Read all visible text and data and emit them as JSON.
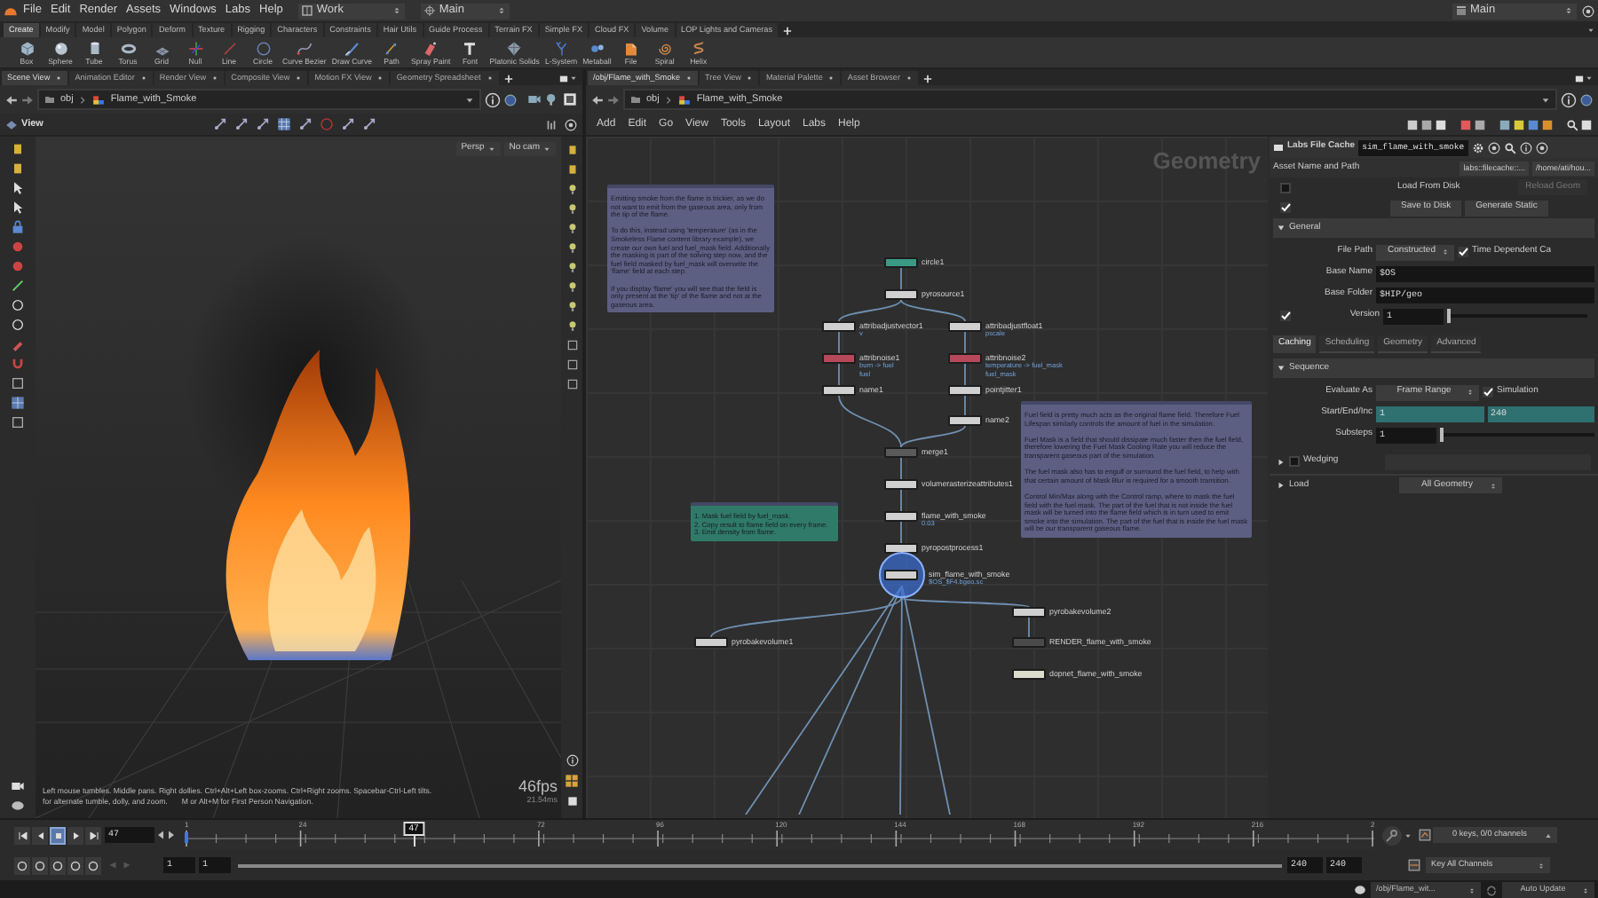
{
  "menu": [
    "File",
    "Edit",
    "Render",
    "Assets",
    "Windows",
    "Labs",
    "Help"
  ],
  "desktop": "Work",
  "context": "Main",
  "right_context": "Main",
  "shelf_tabs": [
    {
      "label": "Create",
      "selected": true
    },
    {
      "label": "Modify",
      "selected": false
    },
    {
      "label": "Model",
      "selected": false
    },
    {
      "label": "Polygon",
      "selected": false
    },
    {
      "label": "Deform",
      "selected": false
    },
    {
      "label": "Texture",
      "selected": false
    },
    {
      "label": "Rigging",
      "selected": false
    },
    {
      "label": "Characters",
      "selected": false
    },
    {
      "label": "Constraints",
      "selected": false
    },
    {
      "label": "Hair Utils",
      "selected": false
    },
    {
      "label": "Guide Process",
      "selected": false
    },
    {
      "label": "Terrain FX",
      "selected": false
    },
    {
      "label": "Simple FX",
      "selected": false
    },
    {
      "label": "Cloud FX",
      "selected": false
    },
    {
      "label": "Volume",
      "selected": false
    },
    {
      "label": "LOP Lights and Cameras",
      "selected": false
    }
  ],
  "shelf_tools": [
    "Box",
    "Sphere",
    "Tube",
    "Torus",
    "Grid",
    "Null",
    "Line",
    "Circle",
    "Curve Bezier",
    "Draw Curve",
    "Path",
    "Spray Paint",
    "Font",
    "Platonic Solids",
    "L-System",
    "Metaball",
    "File",
    "Spiral",
    "Helix"
  ],
  "scene_pane": {
    "tabs": [
      {
        "label": "Scene View",
        "selected": true
      },
      {
        "label": "Animation Editor",
        "selected": false
      },
      {
        "label": "Render View",
        "selected": false
      },
      {
        "label": "Composite View",
        "selected": false
      },
      {
        "label": "Motion FX View",
        "selected": false
      },
      {
        "label": "Geometry Spreadsheet",
        "selected": false
      }
    ],
    "path": [
      "obj",
      "Flame_with_Smoke"
    ],
    "view_label": "View",
    "camera_menus": [
      "Persp",
      "No cam"
    ],
    "help_lines": [
      "Left mouse tumbles. Middle pans. Right dollies. Ctrl+Alt+Left box-zooms. Ctrl+Right zooms. Spacebar-Ctrl-Left tilts.",
      "for alternate tumble, dolly, and zoom.",
      "M or Alt+M for First Person Navigation."
    ],
    "fps": "46fps",
    "frame_time": "21.54ms"
  },
  "network_pane": {
    "tabs": [
      {
        "label": "/obj/Flame_with_Smoke",
        "selected": true
      },
      {
        "label": "Tree View",
        "selected": false
      },
      {
        "label": "Material Palette",
        "selected": false
      },
      {
        "label": "Asset Browser",
        "selected": false
      }
    ],
    "path": [
      "obj",
      "Flame_with_Smoke"
    ],
    "menu": [
      "Add",
      "Edit",
      "Go",
      "View",
      "Tools",
      "Layout",
      "Labs",
      "Help"
    ],
    "context_label": "Geometry",
    "nodes": [
      {
        "name": "circle1",
        "color": "#3a9a84",
        "selected": false
      },
      {
        "name": "pyrosource1",
        "color": "#d0d0d0",
        "selected": false
      },
      {
        "name": "attribadjustvector1",
        "color": "#d0d0d0",
        "selected": false,
        "comments": [
          "v"
        ]
      },
      {
        "name": "attribadjustfloat1",
        "color": "#d0d0d0",
        "selected": false,
        "comments": [
          "pscale"
        ]
      },
      {
        "name": "attribnoise1",
        "color": "#b5485a",
        "selected": false,
        "comments": [
          "burn -> fuel",
          "fuel"
        ]
      },
      {
        "name": "attribnoise2",
        "color": "#b5485a",
        "selected": false,
        "comments": [
          "temperature -> fuel_mask",
          "fuel_mask"
        ]
      },
      {
        "name": "name1",
        "color": "#d0d0d0",
        "selected": false
      },
      {
        "name": "pointjitter1",
        "color": "#d0d0d0",
        "selected": false
      },
      {
        "name": "name2",
        "color": "#d0d0d0",
        "selected": false
      },
      {
        "name": "merge1",
        "color": "#5a5a5a",
        "selected": false
      },
      {
        "name": "volumerasterizeattributes1",
        "color": "#d0d0d0",
        "selected": false
      },
      {
        "name": "flame_with_smoke",
        "color": "#d0d0d0",
        "selected": false,
        "comments": [
          "0.03"
        ]
      },
      {
        "name": "pyropostprocess1",
        "color": "#d0d0d0",
        "selected": false
      },
      {
        "name": "sim_flame_with_smoke",
        "color": "#d0d0d0",
        "selected": true,
        "comments": [
          "$OS_$F4.bgeo.sc"
        ]
      },
      {
        "name": "pyrobakevolume2",
        "color": "#d0d0d0",
        "selected": false
      },
      {
        "name": "RENDER_flame_with_smoke",
        "color": "#4a4a4a",
        "selected": false
      },
      {
        "name": "dopnet_flame_with_smoke",
        "color": "#dcdccc",
        "selected": false
      },
      {
        "name": "pyrobakevolume1",
        "color": "#d0d0d0",
        "selected": false
      }
    ],
    "notes": [
      {
        "color": "#5c5f82",
        "text": "Emitting smoke from the flame is trickier, as we do not want to emit from the gaseous area, only from the tip of the flame.\n\nTo do this, instead using 'temperature' (as in the Smokeless Flame content library example), we create our own fuel and fuel_mask field. Additionally the masking is part of the solving step now, and the fuel field masked by fuel_mask will overwrite the 'flame' field at each step.\n\nIf you display 'flame' you will see that the field is only present at the 'tip' of the flame and not at the gaseous area."
      },
      {
        "color": "#5c5f82",
        "text": "Fuel field is pretty much acts as the original flame field. Therefore Fuel Lifespan similarly controls the amount of fuel in the simulation.\n\nFuel Mask is a field that should dissipate much faster then the fuel field, therefore lowering the Fuel Mask Cooling Rate you will reduce the transparent gaseous part of the simulation.\n\nThe fuel mask also has to engulf or surround the fuel field, to help with that certain amount of Mask Blur is required for a smooth transition.\n\nControl Min/Max along with the Control ramp, where to mask the fuel field with the fuel mask. The part of the fuel that is not inside the fuel mask will be turned into the flame field which is in turn used to emit smoke into the simulation. The part of the fuel that is inside the fuel mask will be our transparent gaseous flame."
      },
      {
        "color": "#2f7a68",
        "text": "1. Mask fuel field by fuel_mask.\n2. Copy result to flame field on every frame.\n3. Emit density from flame."
      }
    ]
  },
  "parameters": {
    "type_label": "Labs File Cache",
    "node_name": "sim_flame_with_smoke",
    "asset_row": {
      "label": "Asset Name and Path",
      "name": "labs::filecache::...",
      "path": "/home/ati/hou..."
    },
    "load_from_disk": {
      "label": "Load From Disk",
      "checked": false
    },
    "reload_button": {
      "label": "Reload Geom",
      "disabled": true
    },
    "save_toggle": {
      "checked": true
    },
    "buttons": [
      "Save to Disk",
      "Generate Static"
    ],
    "general": {
      "label": "General",
      "expanded": true
    },
    "file_path": {
      "label": "File Path",
      "value": "Constructed",
      "option": {
        "label": "Time Dependent Ca",
        "checked": true
      }
    },
    "base_name": {
      "label": "Base Name",
      "value": "$OS"
    },
    "base_folder": {
      "label": "Base Folder",
      "value": "$HIP/geo"
    },
    "version": {
      "label": "Version",
      "value": "1",
      "checked": true,
      "level": 0
    },
    "tabs": [
      {
        "label": "Caching",
        "selected": true
      },
      {
        "label": "Scheduling",
        "selected": false
      },
      {
        "label": "Geometry",
        "selected": false
      },
      {
        "label": "Advanced",
        "selected": false
      }
    ],
    "sequence": {
      "label": "Sequence",
      "expanded": true
    },
    "evaluate_as": {
      "label": "Evaluate As",
      "value": "Frame Range",
      "option": {
        "label": "Simulation",
        "checked": true
      }
    },
    "range": {
      "label": "Start/End/Inc",
      "values": [
        "1",
        "240"
      ]
    },
    "substeps": {
      "label": "Substeps",
      "value": "1",
      "level": 0
    },
    "wedging": {
      "label": "Wedging",
      "expanded": false,
      "checked": false
    },
    "load": {
      "label": "Load",
      "expanded": false,
      "value": "All Geometry"
    }
  },
  "timeline": {
    "playback_buttons": [
      {
        "kind": "first",
        "selected": false
      },
      {
        "kind": "prev",
        "selected": false
      },
      {
        "kind": "stop",
        "selected": true
      },
      {
        "kind": "play",
        "selected": false
      },
      {
        "kind": "last",
        "selected": false
      }
    ],
    "frame": "47",
    "playhead": {
      "label": "47",
      "level": 0.1925
    },
    "ruler_labels": [
      "1",
      "24",
      "72",
      "96",
      "120",
      "144",
      "168",
      "192",
      "216",
      "2"
    ],
    "range_start": [
      "1",
      "1"
    ],
    "range_end": [
      "240",
      "240"
    ],
    "range": {
      "level": 1
    },
    "keys_info": "0 keys, 0/0 channels",
    "key_mode": "Key All Channels"
  },
  "status_bar": {
    "path": "/obj/Flame_wit...",
    "update_mode": "Auto Update"
  }
}
